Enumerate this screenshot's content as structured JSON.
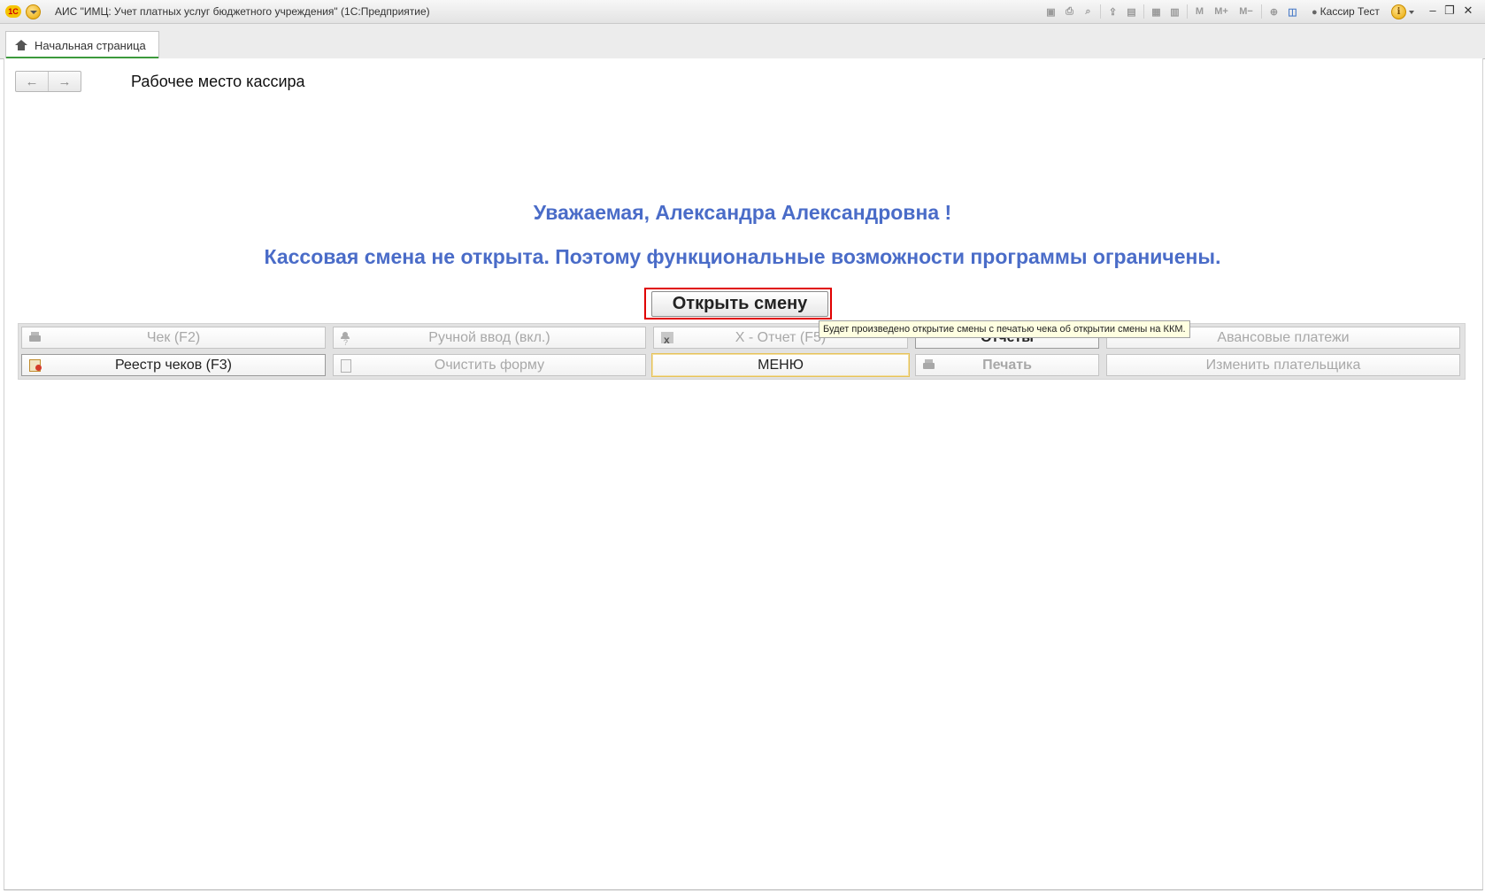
{
  "titlebar": {
    "logo_text": "1С",
    "app_title": "АИС \"ИМЦ: Учет платных услуг бюджетного учреждения\"  (1С:Предприятие)",
    "icons": [
      "save-icon",
      "print-icon",
      "print-preview-icon",
      "upload-icon",
      "scanner-icon",
      "calculator-icon",
      "calendar-icon",
      "memory-m-icon",
      "memory-plus-icon",
      "memory-minus-icon",
      "zoom-icon",
      "panels-icon"
    ],
    "m_label": "M",
    "m_plus_label": "M+",
    "m_minus_label": "M−",
    "user_name": "Кассир Тест",
    "info_label": "i",
    "minimize": "–",
    "restore": "❐",
    "close": "✕"
  },
  "tabs": [
    {
      "label": "Начальная страница",
      "active": true
    }
  ],
  "page": {
    "back_label": "←",
    "forward_label": "→",
    "title": "Рабочее место кассира",
    "greeting": "Уважаемая, Александра Александровна !",
    "warning": "Кассовая смена не открыта. Поэтому функциональные возможности программы ограничены.",
    "open_shift_label": "Открыть смену",
    "tooltip": "Будет произведено открытие смены с печатью чека об открытии смены на ККМ."
  },
  "commands": {
    "row1": [
      {
        "label": "Чек (F2)",
        "icon": "printer-icon",
        "enabled": false
      },
      {
        "label": "Ручной ввод (вкл.)",
        "icon": "user-question-icon",
        "enabled": false
      },
      {
        "label": "X - Отчет (F5)",
        "icon": "report-icon",
        "enabled": false
      },
      {
        "label": "Отчеты",
        "icon": "",
        "enabled": true
      },
      {
        "label": "Авансовые платежи",
        "icon": "",
        "enabled": false
      }
    ],
    "row2": [
      {
        "label": "Реестр чеков (F3)",
        "icon": "registry-icon",
        "enabled": true
      },
      {
        "label": "Очистить форму",
        "icon": "document-icon",
        "enabled": false
      },
      {
        "label": "МЕНЮ",
        "icon": "",
        "enabled": true
      },
      {
        "label": "Печать",
        "icon": "printer-icon",
        "enabled": false
      },
      {
        "label": "Изменить плательщика",
        "icon": "",
        "enabled": false
      }
    ]
  },
  "colors": {
    "accent_blue": "#4a6cc8",
    "highlight_red": "#e00000",
    "tab_green": "#3c9a3c",
    "tooltip_bg": "#ffffe1"
  }
}
